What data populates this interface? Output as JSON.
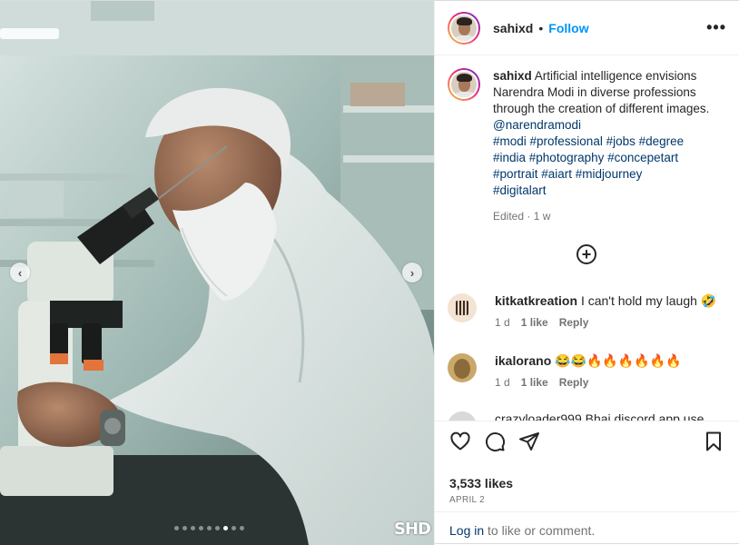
{
  "post": {
    "username": "sahixd",
    "follow_label": "Follow",
    "more_icon": "more-options-icon",
    "caption": {
      "username": "sahixd",
      "text": "Artificial intelligence envisions Narendra Modi in diverse professions through the creation of different images.",
      "mention": "@narendramodi",
      "hashtags_line1": "#modi #professional #jobs #degree",
      "hashtags_line2": "#india #photography #concepetart",
      "hashtags_line3": "#portrait #aiart #midjourney",
      "hashtags_line4": "#digitalart",
      "edited": "Edited · 1 w"
    },
    "comments": [
      {
        "username": "kitkatkreation",
        "text": "I can't hold my laugh 🤣",
        "age": "1 d",
        "likes": "1 like",
        "reply": "Reply"
      },
      {
        "username": "ikalorano",
        "text": "😂😂🔥🔥🔥🔥🔥🔥",
        "age": "1 d",
        "likes": "1 like",
        "reply": "Reply"
      }
    ],
    "cut_comment": "crazyloader999 Bhai discord app use",
    "likes": "3,533 likes",
    "date": "APRIL 2",
    "login_link": "Log in",
    "login_rest": " to like or comment.",
    "watermark": "SHD",
    "carousel": {
      "total": 9,
      "active_index": 6
    }
  },
  "colors": {
    "link": "#0095f6",
    "hashtag": "#00376b",
    "muted": "#737373"
  }
}
